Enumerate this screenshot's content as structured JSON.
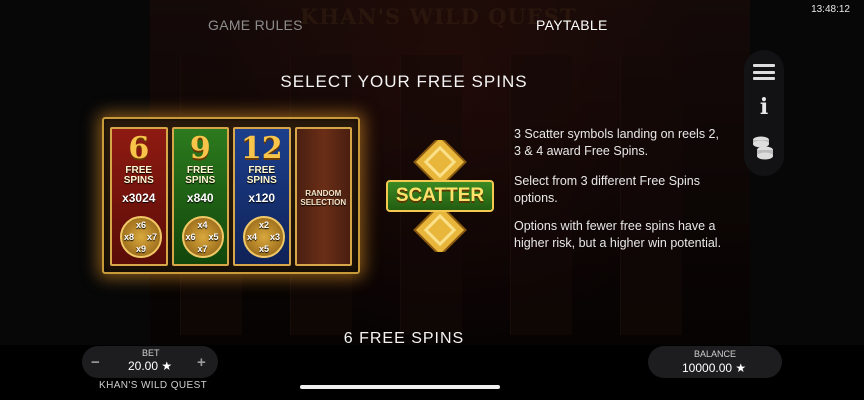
{
  "status": {
    "time": "13:48:12"
  },
  "tabs": {
    "game_rules": "GAME RULES",
    "paytable": "PAYTABLE"
  },
  "background": {
    "title": "KHAN'S WILD QUEST"
  },
  "side_menu": {
    "icons": [
      "menu-icon",
      "info-icon",
      "coins-icon"
    ]
  },
  "paytable": {
    "heading": "SELECT YOUR FREE SPINS",
    "cards": [
      {
        "spins": "6",
        "label": "FREE SPINS",
        "multiplier": "x3024",
        "medallion": [
          "x6",
          "x8",
          "x7",
          "x9"
        ],
        "color": "#8e1b12"
      },
      {
        "spins": "9",
        "label": "FREE SPINS",
        "multiplier": "x840",
        "medallion": [
          "x4",
          "x6",
          "x5",
          "x7"
        ],
        "color": "#2c7a1e"
      },
      {
        "spins": "12",
        "label": "FREE SPINS",
        "multiplier": "x120",
        "medallion": [
          "x2",
          "x4",
          "x3",
          "x5"
        ],
        "color": "#1d3f8c"
      },
      {
        "label": "RANDOM SELECTION"
      }
    ],
    "scatter_label": "SCATTER",
    "description": [
      "3 Scatter symbols landing on reels 2, 3 & 4 award Free Spins.",
      "Select from 3 different Free Spins options.",
      "Options with fewer free spins have a higher risk, but a higher win potential."
    ],
    "subheading": "6 FREE SPINS"
  },
  "footer": {
    "bet_label": "BET",
    "bet_value": "20.00 ★",
    "minus": "−",
    "plus": "+",
    "game_name": "KHAN'S WILD QUEST",
    "balance_label": "BALANCE",
    "balance_value": "10000.00 ★"
  },
  "colors": {
    "glow": "#e69628",
    "gold": "#d7a648",
    "scatter_green": "#3b8a22"
  }
}
